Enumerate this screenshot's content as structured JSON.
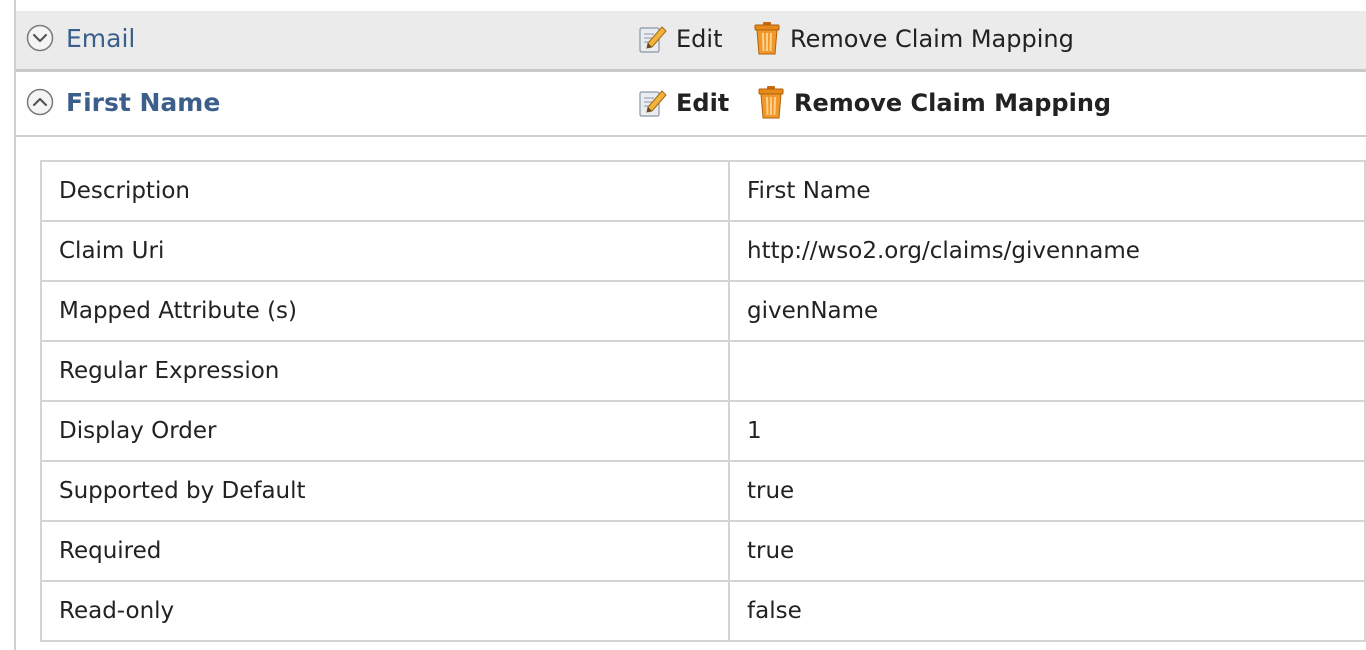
{
  "claims": [
    {
      "title": "Email",
      "state": "collapsed",
      "edit_label": "Edit",
      "remove_label": "Remove Claim Mapping",
      "toggle_icon": "chevron-down-circle-icon"
    },
    {
      "title": "First Name",
      "state": "expanded",
      "edit_label": "Edit",
      "remove_label": "Remove Claim Mapping",
      "toggle_icon": "chevron-up-circle-icon"
    }
  ],
  "details": {
    "rows": [
      {
        "label": "Description",
        "value": "First Name"
      },
      {
        "label": "Claim Uri",
        "value": "http://wso2.org/claims/givenname"
      },
      {
        "label": "Mapped Attribute (s)",
        "value": "givenName"
      },
      {
        "label": "Regular Expression",
        "value": ""
      },
      {
        "label": "Display Order",
        "value": "1"
      },
      {
        "label": "Supported by Default",
        "value": "true"
      },
      {
        "label": "Required",
        "value": "true"
      },
      {
        "label": "Read-only",
        "value": "false"
      }
    ]
  },
  "colors": {
    "link_title": "#3b5f8a",
    "collapsed_bg": "#ebebeb",
    "border": "#d4d4d4",
    "trash": "#e8891b"
  },
  "icons": {
    "edit": "edit-pencil-icon",
    "remove": "trash-can-icon"
  }
}
